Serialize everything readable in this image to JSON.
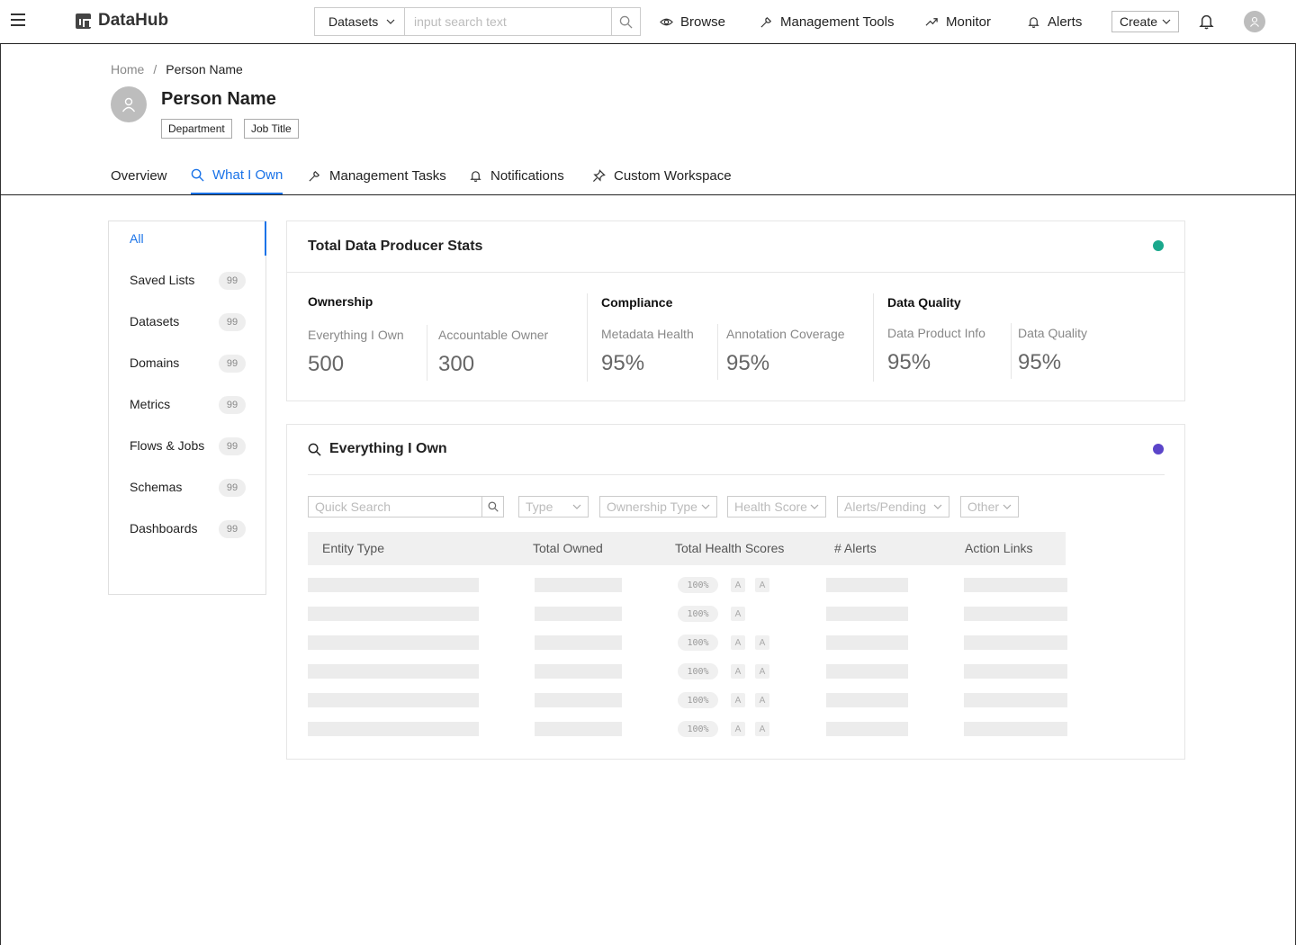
{
  "app": {
    "name": "DataHub"
  },
  "header": {
    "search": {
      "select_label": "Datasets",
      "placeholder": "input search text"
    },
    "nav": [
      {
        "label": "Browse",
        "icon": "eye-icon"
      },
      {
        "label": "Management Tools",
        "icon": "wrench-icon"
      },
      {
        "label": "Monitor",
        "icon": "trend-icon"
      },
      {
        "label": "Alerts",
        "icon": "bell-icon"
      }
    ],
    "create_label": "Create"
  },
  "breadcrumb": {
    "home": "Home",
    "separator": "/",
    "current": "Person Name"
  },
  "person": {
    "name": "Person Name",
    "tags": [
      "Department",
      "Job Title"
    ]
  },
  "tabs": [
    {
      "label": "Overview",
      "active": false
    },
    {
      "label": "What I Own",
      "active": true
    },
    {
      "label": "Management Tasks",
      "active": false
    },
    {
      "label": "Notifications",
      "active": false
    },
    {
      "label": "Custom Workspace",
      "active": false
    }
  ],
  "sidebar": {
    "items": [
      {
        "label": "All",
        "count": null,
        "active": true
      },
      {
        "label": "Saved Lists",
        "count": "99"
      },
      {
        "label": "Datasets",
        "count": "99"
      },
      {
        "label": "Domains",
        "count": "99"
      },
      {
        "label": "Metrics",
        "count": "99"
      },
      {
        "label": "Flows & Jobs",
        "count": "99"
      },
      {
        "label": "Schemas",
        "count": "99"
      },
      {
        "label": "Dashboards",
        "count": "99"
      }
    ]
  },
  "stats_card": {
    "title": "Total Data Producer Stats",
    "dot_color": "#1aa88c",
    "groups": [
      {
        "title": "Ownership",
        "items": [
          {
            "label": "Everything I Own",
            "value": "500"
          },
          {
            "label": "Accountable Owner",
            "value": "300"
          }
        ]
      },
      {
        "title": "Compliance",
        "items": [
          {
            "label": "Metadata Health",
            "value": "95%"
          },
          {
            "label": "Annotation Coverage",
            "value": "95%"
          }
        ]
      },
      {
        "title": "Data Quality",
        "items": [
          {
            "label": "Data Product Info",
            "value": "95%"
          },
          {
            "label": "Data Quality",
            "value": "95%"
          }
        ]
      }
    ]
  },
  "own_card": {
    "title": "Everything I Own",
    "dot_color": "#5b45c9",
    "quick_search_placeholder": "Quick Search",
    "filters": [
      "Type",
      "Ownership Type",
      "Health Score",
      "Alerts/Pending",
      "Other"
    ],
    "columns": [
      "Entity Type",
      "Total Owned",
      "Total Health Scores",
      "# Alerts",
      "Action Links"
    ],
    "rows": [
      {
        "health": "100%",
        "chips": [
          "A",
          "A"
        ]
      },
      {
        "health": "100%",
        "chips": [
          "A"
        ]
      },
      {
        "health": "100%",
        "chips": [
          "A",
          "A"
        ]
      },
      {
        "health": "100%",
        "chips": [
          "A",
          "A"
        ]
      },
      {
        "health": "100%",
        "chips": [
          "A",
          "A"
        ]
      },
      {
        "health": "100%",
        "chips": [
          "A",
          "A"
        ]
      }
    ]
  }
}
